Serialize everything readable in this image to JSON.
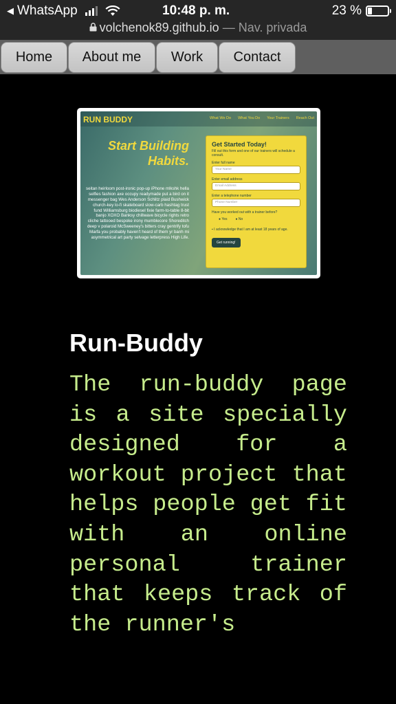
{
  "statusbar": {
    "back_app": "WhatsApp",
    "time": "10:48 p. m.",
    "battery": "23 %",
    "battery_level": 0.23
  },
  "urlbar": {
    "domain": "volchenok89.github.io",
    "mode": " — Nav. privada"
  },
  "nav": {
    "items": [
      "Home",
      "About me",
      "Work",
      "Contact"
    ]
  },
  "project": {
    "screenshot": {
      "logo": "RUN BUDDY",
      "nav": [
        "What We Do",
        "What You Do",
        "Your Trainers",
        "Reach Out"
      ],
      "hero": "Start Building Habits.",
      "lorem": "seitan heirloom post-ironic pop-up iPhone mlkshk hella selfies fashion axe occupy readymade put a bird on it messenger bag Wes Anderson Schlitz plaid Bushwick church-key lo-fi skateboard slow-carb hashtag trust fund Williamsburg biodiesel fixie farm-to-table 8-bit banjo XOXO Banksy chillwave bicycle rights retro cliche tattooed bespoke irony mumblecore Shoreditch deep v polaroid McSweeney's bitters cray gentrify tofu Marfa you probably haven't heard of them yr banh mi asymmetrical art party selvage letterpress High Life.",
      "form": {
        "title": "Get Started Today!",
        "intro": "Fill out this form and one of our trainers will schedule a consult.",
        "name_label": "Enter full name",
        "name_placeholder": "Your Name",
        "email_label": "Enter email address",
        "email_placeholder": "Email Address",
        "phone_label": "Enter a telephone number",
        "phone_placeholder": "Phone Number",
        "question": "Have you worked out with a trainer before?",
        "yes": "Yes",
        "no": "No",
        "ack": "I acknowledge that I am at least 18 years of age.",
        "button": "Get running!"
      }
    },
    "title": "Run-Buddy",
    "description": "The run-buddy page is a site specially designed for a workout project that helps people get fit with an online personal trainer that keeps track of the runner's"
  }
}
